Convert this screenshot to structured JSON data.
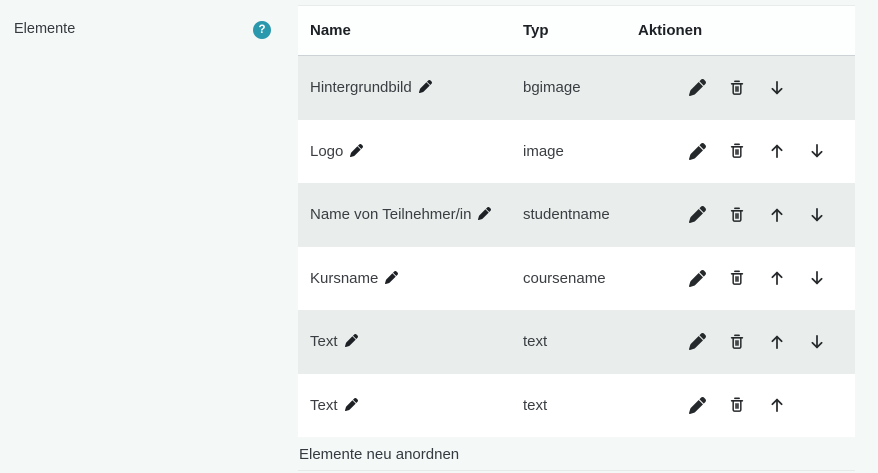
{
  "setting": {
    "label": "Elemente",
    "help_icon_glyph": "?"
  },
  "table": {
    "headers": {
      "name": "Name",
      "type": "Typ",
      "actions": "Aktionen"
    },
    "rows": [
      {
        "name": "Hintergrundbild",
        "type": "bgimage",
        "actions": [
          "edit",
          "delete",
          "move-down"
        ]
      },
      {
        "name": "Logo",
        "type": "image",
        "actions": [
          "edit",
          "delete",
          "move-up",
          "move-down"
        ]
      },
      {
        "name": "Name von Teilnehmer/in",
        "type": "studentname",
        "actions": [
          "edit",
          "delete",
          "move-up",
          "move-down"
        ]
      },
      {
        "name": "Kursname",
        "type": "coursename",
        "actions": [
          "edit",
          "delete",
          "move-up",
          "move-down"
        ]
      },
      {
        "name": "Text",
        "type": "text",
        "actions": [
          "edit",
          "delete",
          "move-up",
          "move-down"
        ]
      },
      {
        "name": "Text",
        "type": "text",
        "actions": [
          "edit",
          "delete",
          "move-up"
        ]
      }
    ]
  },
  "footer": {
    "reposition_label": "Elemente neu anordnen"
  },
  "colors": {
    "page_background": "#f4f8f7",
    "stripe_row": "#e9eeec",
    "help_icon_background": "#2a98ad",
    "icon_color": "#26292b"
  }
}
